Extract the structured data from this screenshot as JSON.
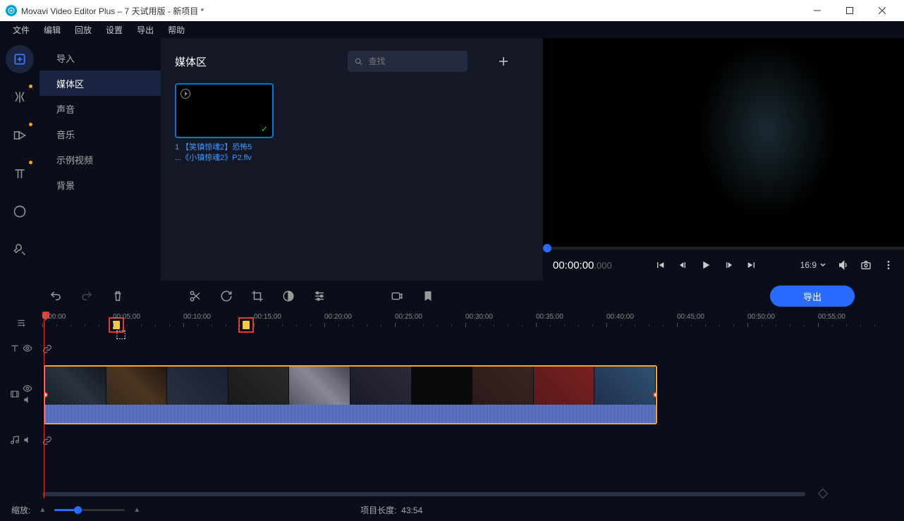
{
  "window_title": "Movavi Video Editor Plus – 7 天试用版 - 新项目 *",
  "menu": [
    "文件",
    "编辑",
    "回放",
    "设置",
    "导出",
    "帮助"
  ],
  "rail_icons": [
    "import-icon",
    "magic-icon",
    "transitions-icon",
    "titles-icon",
    "stickers-icon",
    "tools-icon"
  ],
  "sidebar": {
    "items": [
      "导入",
      "媒体区",
      "声音",
      "音乐",
      "示例视频",
      "背景"
    ],
    "selected_index": 1
  },
  "media": {
    "heading": "媒体区",
    "search_placeholder": "查找",
    "clip_line1": "1 【笑镇惊魂2】恐怖5",
    "clip_line2": "...《小镇惊魂2》P2.flv"
  },
  "preview": {
    "timecode_main": "00:00:00",
    "timecode_ms": ".000",
    "aspect": "16:9",
    "help_label": "?"
  },
  "toolstrip": {
    "export_label": "导出"
  },
  "timeline": {
    "ticks": [
      "0:00:00",
      "00:05:00",
      "00:10:00",
      "00:15:00",
      "00:20:00",
      "00:25:00",
      "00:30:00",
      "00:35:00",
      "00:40:00",
      "00:45:00",
      "00:50:00",
      "00:55:00"
    ]
  },
  "status": {
    "zoom_label": "缩放:",
    "project_length_label": "项目长度:",
    "project_length_value": "43:54"
  }
}
